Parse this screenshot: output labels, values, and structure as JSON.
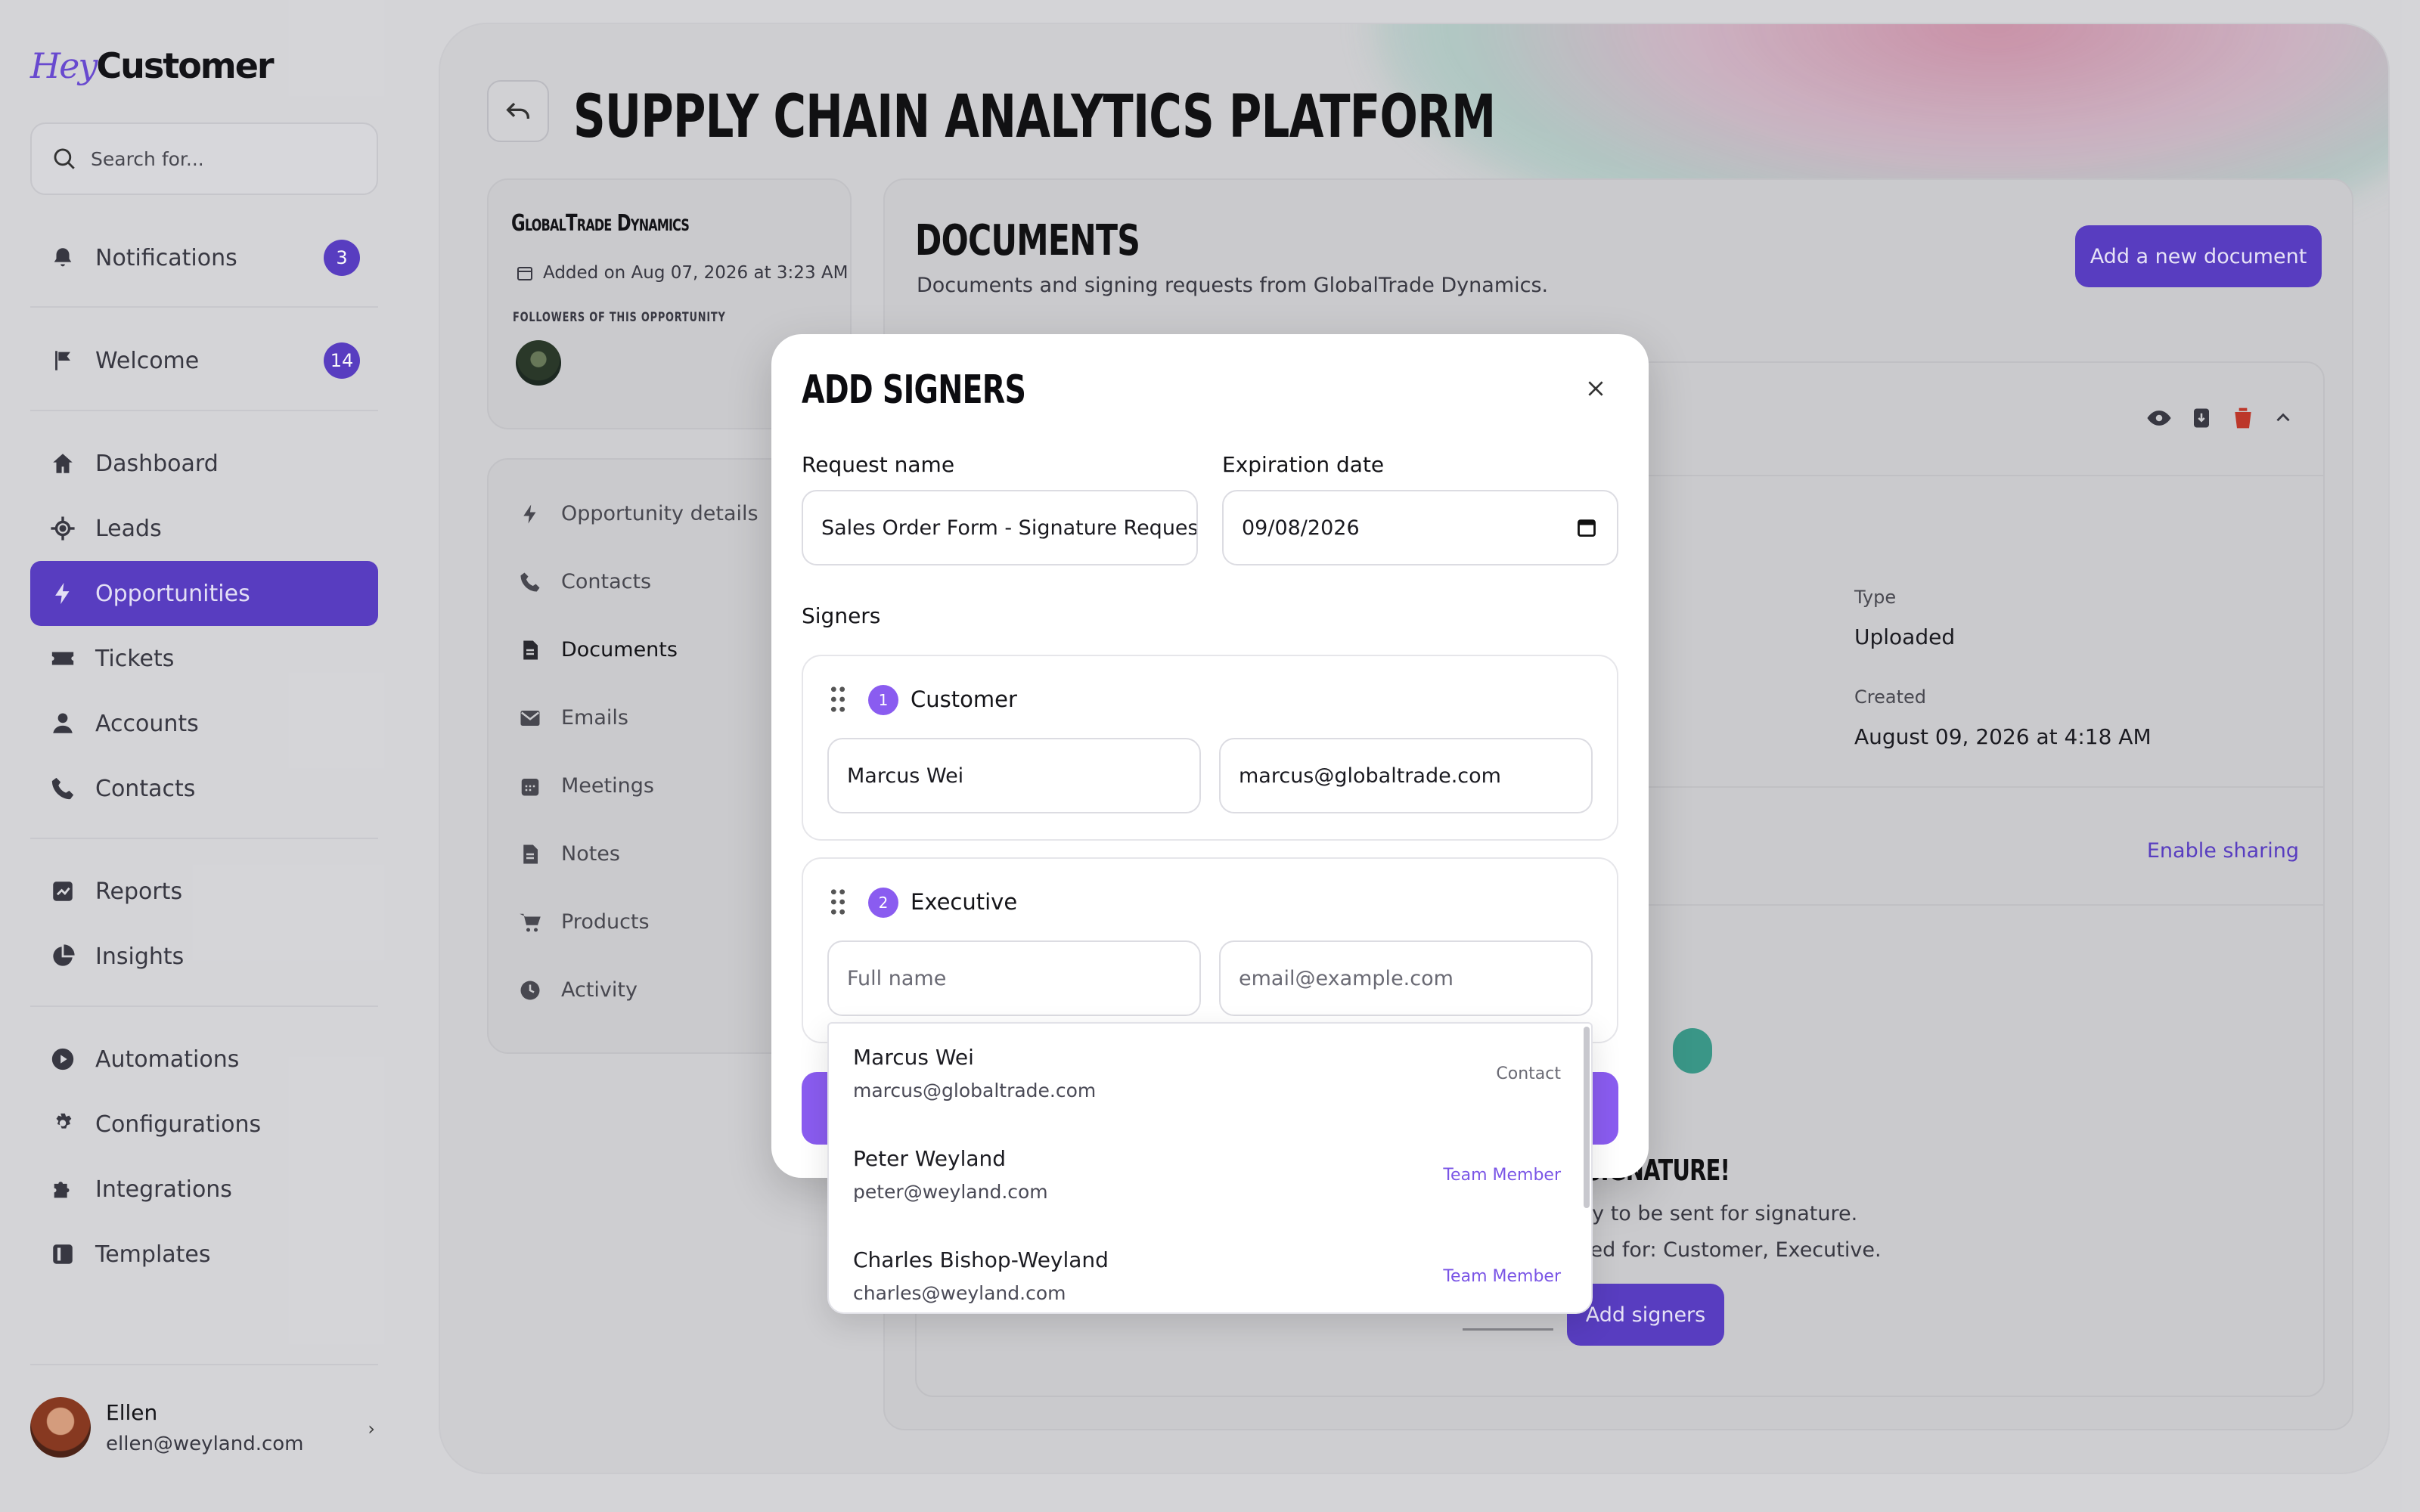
{
  "brand": {
    "logo_hey": "Hey",
    "logo_customer": "Customer"
  },
  "search": {
    "placeholder": "Search for..."
  },
  "sidebar": {
    "notifications": {
      "label": "Notifications",
      "count": "3"
    },
    "welcome": {
      "label": "Welcome",
      "count": "14"
    },
    "items": [
      {
        "label": "Dashboard",
        "icon": "home-icon"
      },
      {
        "label": "Leads",
        "icon": "target-icon"
      },
      {
        "label": "Opportunities",
        "icon": "lightning-icon",
        "active": true
      },
      {
        "label": "Tickets",
        "icon": "ticket-icon"
      },
      {
        "label": "Accounts",
        "icon": "person-icon"
      },
      {
        "label": "Contacts",
        "icon": "phone-icon"
      },
      {
        "label": "Reports",
        "icon": "chart-icon"
      },
      {
        "label": "Insights",
        "icon": "pie-icon"
      },
      {
        "label": "Automations",
        "icon": "play-icon"
      },
      {
        "label": "Configurations",
        "icon": "gear-icon"
      },
      {
        "label": "Integrations",
        "icon": "puzzle-icon"
      },
      {
        "label": "Templates",
        "icon": "template-icon"
      }
    ],
    "user": {
      "name": "Ellen",
      "email": "ellen@weyland.com"
    }
  },
  "page": {
    "title": "SUPPLY CHAIN ANALYTICS PLATFORM"
  },
  "opportunity": {
    "company": "GlobalTrade Dynamics",
    "added": "Added on Aug 07, 2026 at 3:23 AM",
    "followers_label": "FOLLOWERS OF THIS OPPORTUNITY"
  },
  "opp_menu": [
    {
      "label": "Opportunity details",
      "icon": "lightning-icon"
    },
    {
      "label": "Contacts",
      "icon": "phone-icon"
    },
    {
      "label": "Documents",
      "icon": "document-icon",
      "active": true
    },
    {
      "label": "Emails",
      "icon": "mail-icon"
    },
    {
      "label": "Meetings",
      "icon": "calendar-icon"
    },
    {
      "label": "Notes",
      "icon": "note-icon"
    },
    {
      "label": "Products",
      "icon": "cart-icon"
    },
    {
      "label": "Activity",
      "icon": "clock-icon"
    }
  ],
  "documents": {
    "title": "DOCUMENTS",
    "subtitle": "Documents and signing requests from GlobalTrade Dynamics.",
    "add_button": "Add a new document",
    "type_label": "Type",
    "type_value": "Uploaded",
    "created_label": "Created",
    "created_value": "August 09, 2026 at 4:18 AM",
    "enable_sharing": "Enable sharing",
    "signature_title": "R SIGNATURE!",
    "signature_line1": "dy to be sent for signature.",
    "signature_line2": "red for: Customer, Executive.",
    "add_signers_button": "Add signers"
  },
  "modal": {
    "title": "ADD SIGNERS",
    "request_name_label": "Request name",
    "request_name_value": "Sales Order Form - Signature Request",
    "expiration_label": "Expiration date",
    "expiration_value": "09/08/2026",
    "signers_label": "Signers",
    "signers": [
      {
        "step": "1",
        "role": "Customer",
        "name_value": "Marcus Wei",
        "email_value": "marcus@globaltrade.com"
      },
      {
        "step": "2",
        "role": "Executive",
        "name_placeholder": "Full name",
        "email_placeholder": "email@example.com"
      }
    ]
  },
  "suggestions": [
    {
      "name": "Marcus Wei",
      "email": "marcus@globaltrade.com",
      "tag": "Contact"
    },
    {
      "name": "Peter Weyland",
      "email": "peter@weyland.com",
      "tag": "Team Member"
    },
    {
      "name": "Charles Bishop-Weyland",
      "email": "charles@weyland.com",
      "tag": "Team Member"
    }
  ],
  "colors": {
    "accent": "#5a3fc4",
    "accent_light": "#8a5cf0",
    "danger": "#c0392b"
  }
}
